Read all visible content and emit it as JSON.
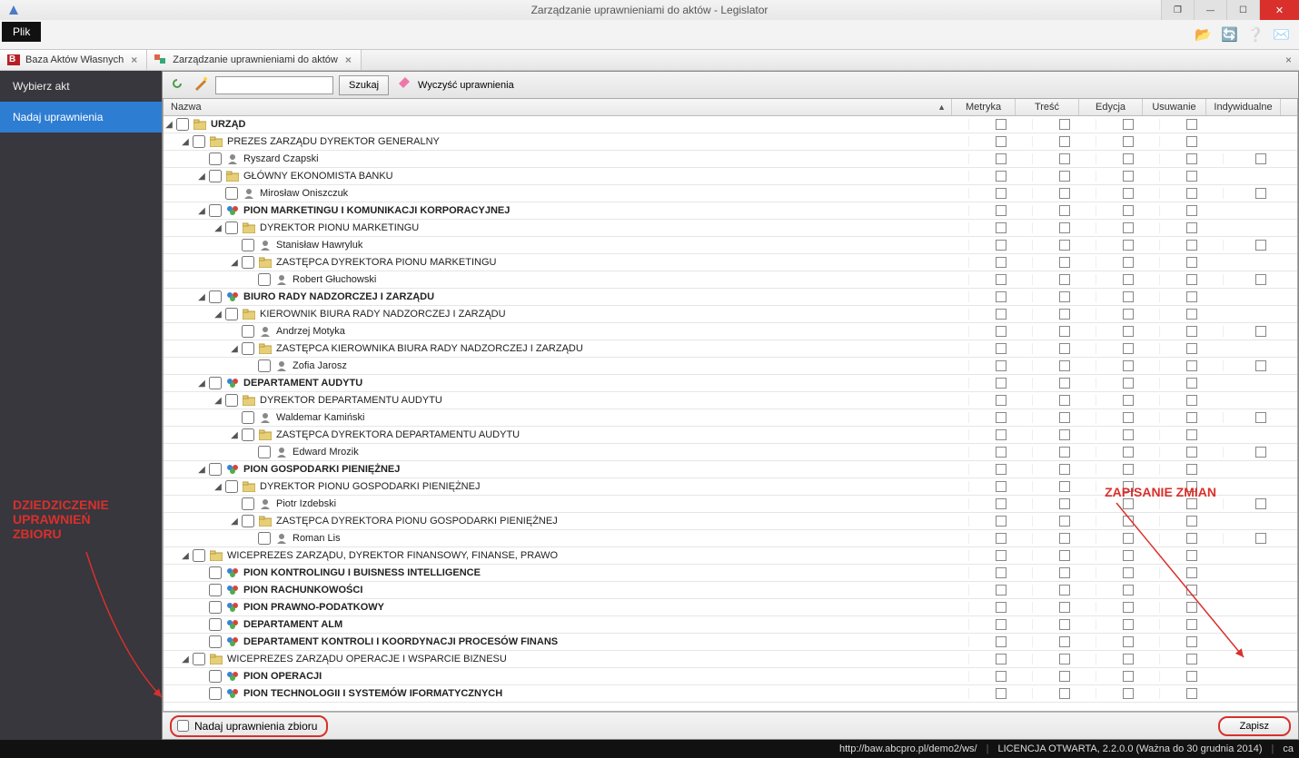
{
  "window": {
    "title": "Zarządzanie uprawnieniami do aktów - Legislator"
  },
  "menubar": {
    "file": "Plik"
  },
  "doctabs": [
    {
      "label": "Baza Aktów Własnych"
    },
    {
      "label": "Zarządzanie uprawnieniami do aktów"
    }
  ],
  "sidebar": {
    "items": [
      {
        "label": "Wybierz akt",
        "active": false
      },
      {
        "label": "Nadaj uprawnienia",
        "active": true
      }
    ]
  },
  "toolbar": {
    "search_btn": "Szukaj",
    "clear_btn": "Wyczyść uprawnienia",
    "search_value": ""
  },
  "grid": {
    "columns": {
      "name": "Nazwa",
      "metryka": "Metryka",
      "tresc": "Treść",
      "edycja": "Edycja",
      "usuwanie": "Usuwanie",
      "indywidualne": "Indywidualne"
    },
    "rows": [
      {
        "depth": 0,
        "exp": true,
        "bold": true,
        "icon": "folder",
        "ind": false,
        "label": "URZĄD"
      },
      {
        "depth": 1,
        "exp": true,
        "bold": false,
        "icon": "folder",
        "ind": false,
        "label": "PREZES ZARZĄDU DYREKTOR GENERALNY"
      },
      {
        "depth": 2,
        "exp": null,
        "bold": false,
        "icon": "person",
        "ind": true,
        "label": "Ryszard Czapski"
      },
      {
        "depth": 2,
        "exp": true,
        "bold": false,
        "icon": "folder",
        "ind": false,
        "label": "GŁÓWNY EKONOMISTA BANKU"
      },
      {
        "depth": 3,
        "exp": null,
        "bold": false,
        "icon": "person",
        "ind": true,
        "label": "Mirosław Oniszczuk"
      },
      {
        "depth": 2,
        "exp": true,
        "bold": true,
        "icon": "group",
        "ind": false,
        "label": "PION MARKETINGU I KOMUNIKACJI KORPORACYJNEJ"
      },
      {
        "depth": 3,
        "exp": true,
        "bold": false,
        "icon": "folder",
        "ind": false,
        "label": "DYREKTOR PIONU MARKETINGU"
      },
      {
        "depth": 4,
        "exp": null,
        "bold": false,
        "icon": "person",
        "ind": true,
        "label": "Stanisław Hawryluk"
      },
      {
        "depth": 4,
        "exp": true,
        "bold": false,
        "icon": "folder",
        "ind": false,
        "label": "ZASTĘPCA DYREKTORA PIONU MARKETINGU"
      },
      {
        "depth": 5,
        "exp": null,
        "bold": false,
        "icon": "person",
        "ind": true,
        "label": "Robert Głuchowski"
      },
      {
        "depth": 2,
        "exp": true,
        "bold": true,
        "icon": "group",
        "ind": false,
        "label": "BIURO RADY NADZORCZEJ I ZARZĄDU"
      },
      {
        "depth": 3,
        "exp": true,
        "bold": false,
        "icon": "folder",
        "ind": false,
        "label": "KIEROWNIK BIURA RADY NADZORCZEJ I ZARZĄDU"
      },
      {
        "depth": 4,
        "exp": null,
        "bold": false,
        "icon": "person",
        "ind": true,
        "label": "Andrzej Motyka"
      },
      {
        "depth": 4,
        "exp": true,
        "bold": false,
        "icon": "folder",
        "ind": false,
        "label": "ZASTĘPCA KIEROWNIKA BIURA RADY NADZORCZEJ I ZARZĄDU"
      },
      {
        "depth": 5,
        "exp": null,
        "bold": false,
        "icon": "person",
        "ind": true,
        "label": "Zofia Jarosz"
      },
      {
        "depth": 2,
        "exp": true,
        "bold": true,
        "icon": "group",
        "ind": false,
        "label": "DEPARTAMENT AUDYTU"
      },
      {
        "depth": 3,
        "exp": true,
        "bold": false,
        "icon": "folder",
        "ind": false,
        "label": "DYREKTOR DEPARTAMENTU AUDYTU"
      },
      {
        "depth": 4,
        "exp": null,
        "bold": false,
        "icon": "person",
        "ind": true,
        "label": "Waldemar Kamiński"
      },
      {
        "depth": 4,
        "exp": true,
        "bold": false,
        "icon": "folder",
        "ind": false,
        "label": "ZASTĘPCA DYREKTORA DEPARTAMENTU AUDYTU"
      },
      {
        "depth": 5,
        "exp": null,
        "bold": false,
        "icon": "person",
        "ind": true,
        "label": "Edward Mrozik"
      },
      {
        "depth": 2,
        "exp": true,
        "bold": true,
        "icon": "group",
        "ind": false,
        "label": "PION GOSPODARKI PIENIĘŻNEJ"
      },
      {
        "depth": 3,
        "exp": true,
        "bold": false,
        "icon": "folder",
        "ind": false,
        "label": "DYREKTOR PIONU GOSPODARKI PIENIĘŻNEJ"
      },
      {
        "depth": 4,
        "exp": null,
        "bold": false,
        "icon": "person",
        "ind": true,
        "label": "Piotr Izdebski"
      },
      {
        "depth": 4,
        "exp": true,
        "bold": false,
        "icon": "folder",
        "ind": false,
        "label": "ZASTĘPCA DYREKTORA PIONU GOSPODARKI PIENIĘŻNEJ"
      },
      {
        "depth": 5,
        "exp": null,
        "bold": false,
        "icon": "person",
        "ind": true,
        "label": "Roman Lis"
      },
      {
        "depth": 1,
        "exp": true,
        "bold": false,
        "icon": "folder",
        "ind": false,
        "label": "WICEPREZES ZARZĄDU, DYREKTOR FINANSOWY, FINANSE, PRAWO"
      },
      {
        "depth": 2,
        "exp": null,
        "bold": true,
        "icon": "group",
        "ind": false,
        "label": "PION KONTROLINGU I BUISNESS INTELLIGENCE"
      },
      {
        "depth": 2,
        "exp": null,
        "bold": true,
        "icon": "group",
        "ind": false,
        "label": "PION RACHUNKOWOŚCI"
      },
      {
        "depth": 2,
        "exp": null,
        "bold": true,
        "icon": "group",
        "ind": false,
        "label": "PION PRAWNO-PODATKOWY"
      },
      {
        "depth": 2,
        "exp": null,
        "bold": true,
        "icon": "group",
        "ind": false,
        "label": "DEPARTAMENT ALM"
      },
      {
        "depth": 2,
        "exp": null,
        "bold": true,
        "icon": "group",
        "ind": false,
        "label": "DEPARTAMENT KONTROLI I KOORDYNACJI PROCESÓW FINANS"
      },
      {
        "depth": 1,
        "exp": true,
        "bold": false,
        "icon": "folder",
        "ind": false,
        "label": "WICEPREZES ZARZĄDU OPERACJE I WSPARCIE BIZNESU"
      },
      {
        "depth": 2,
        "exp": null,
        "bold": true,
        "icon": "group",
        "ind": false,
        "label": "PION OPERACJI"
      },
      {
        "depth": 2,
        "exp": null,
        "bold": true,
        "icon": "group",
        "ind": false,
        "label": "PION TECHNOLOGII I SYSTEMÓW IFORMATYCZNYCH"
      }
    ]
  },
  "bottom": {
    "inherit_label": "Nadaj uprawnienia zbioru",
    "save": "Zapisz"
  },
  "annotations": {
    "left": "DZIEDZICZENIE\nUPRAWNIEŃ\nZBIORU",
    "right": "ZAPISANIE ZMIAN"
  },
  "status": {
    "url": "http://baw.abcpro.pl/demo2/ws/",
    "license": "LICENCJA OTWARTA, 2.2.0.0 (Ważna do 30 grudnia 2014)",
    "user": "ca"
  }
}
